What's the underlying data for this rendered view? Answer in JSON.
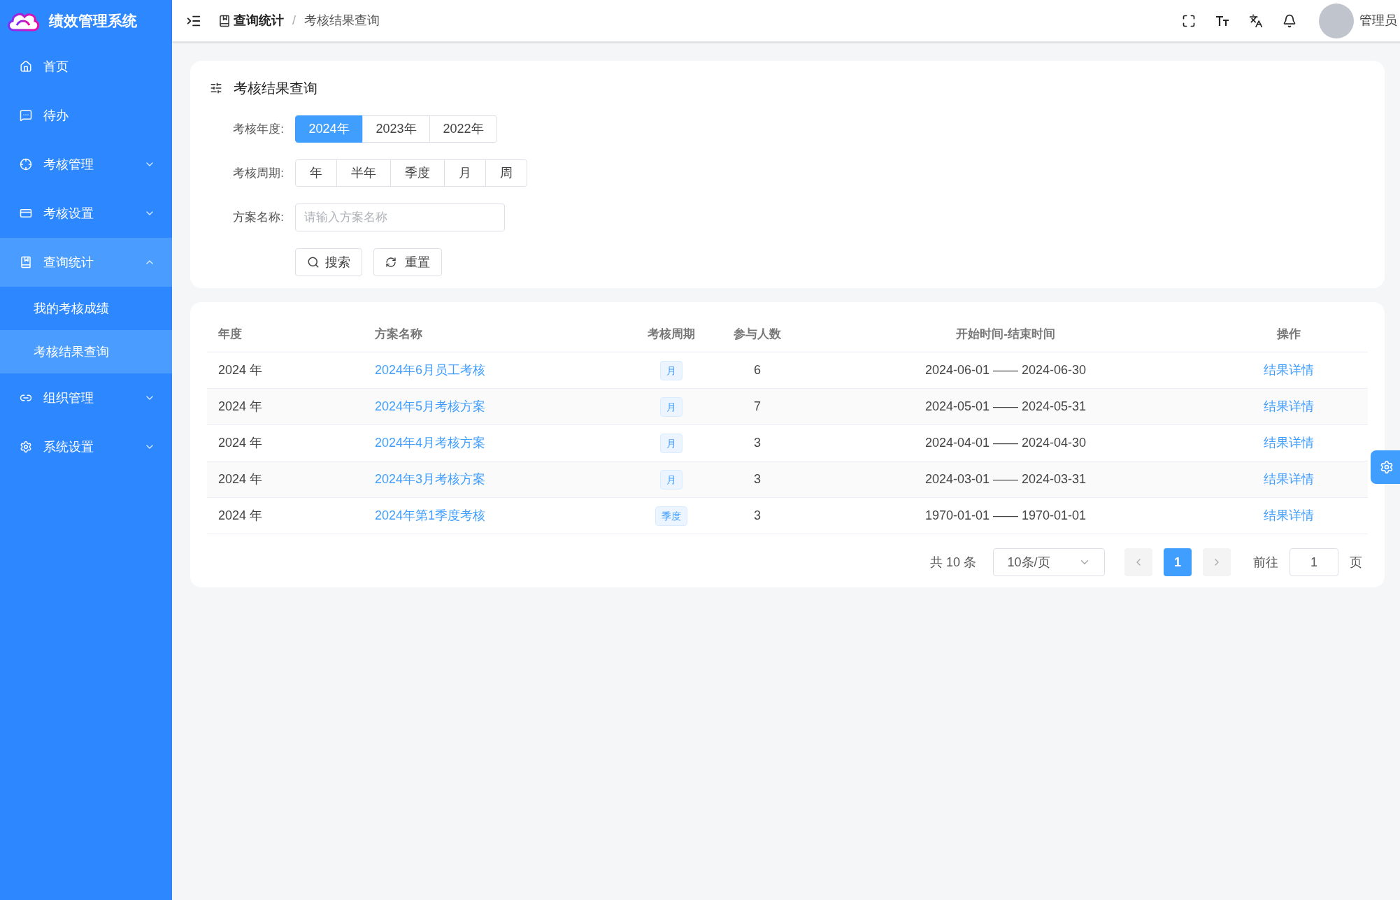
{
  "app": {
    "title": "绩效管理系统"
  },
  "sidebar": {
    "items": [
      {
        "label": "首页",
        "kind": "link",
        "selected": false
      },
      {
        "label": "待办",
        "kind": "link",
        "selected": false
      },
      {
        "label": "考核管理",
        "kind": "group",
        "expanded": false,
        "selected": false
      },
      {
        "label": "考核设置",
        "kind": "group",
        "expanded": false,
        "selected": false
      },
      {
        "label": "查询统计",
        "kind": "group",
        "expanded": true,
        "selected": true,
        "children": [
          {
            "label": "我的考核成绩",
            "selected": false
          },
          {
            "label": "考核结果查询",
            "selected": true
          }
        ]
      },
      {
        "label": "组织管理",
        "kind": "group",
        "expanded": false,
        "selected": false
      },
      {
        "label": "系统设置",
        "kind": "group",
        "expanded": false,
        "selected": false
      }
    ]
  },
  "header": {
    "breadcrumb": [
      "查询统计",
      "考核结果查询"
    ],
    "separator": "/",
    "user": "管理员"
  },
  "filter": {
    "title": "考核结果查询",
    "year_label": "考核年度:",
    "years": [
      {
        "label": "2024年",
        "selected": true
      },
      {
        "label": "2023年",
        "selected": false
      },
      {
        "label": "2022年",
        "selected": false
      }
    ],
    "period_label": "考核周期:",
    "periods": [
      {
        "label": "年",
        "selected": false
      },
      {
        "label": "半年",
        "selected": false
      },
      {
        "label": "季度",
        "selected": false
      },
      {
        "label": "月",
        "selected": false
      },
      {
        "label": "周",
        "selected": false
      }
    ],
    "name_label": "方案名称:",
    "name_placeholder": "请输入方案名称",
    "search_button": "搜索",
    "reset_button": "重置"
  },
  "table": {
    "columns": [
      "年度",
      "方案名称",
      "考核周期",
      "参与人数",
      "开始时间-结束时间",
      "操作"
    ],
    "rows": [
      {
        "year": "2024 年",
        "name": "2024年6月员工考核",
        "period": "月",
        "count": "6",
        "range": "2024-06-01 —— 2024-06-30",
        "action": "结果详情"
      },
      {
        "year": "2024 年",
        "name": "2024年5月考核方案",
        "period": "月",
        "count": "7",
        "range": "2024-05-01 —— 2024-05-31",
        "action": "结果详情"
      },
      {
        "year": "2024 年",
        "name": "2024年4月考核方案",
        "period": "月",
        "count": "3",
        "range": "2024-04-01 —— 2024-04-30",
        "action": "结果详情"
      },
      {
        "year": "2024 年",
        "name": "2024年3月考核方案",
        "period": "月",
        "count": "3",
        "range": "2024-03-01 —— 2024-03-31",
        "action": "结果详情"
      },
      {
        "year": "2024 年",
        "name": "2024年第1季度考核",
        "period": "季度",
        "count": "3",
        "range": "1970-01-01 —— 1970-01-01",
        "action": "结果详情"
      }
    ]
  },
  "pagination": {
    "total": "共 10 条",
    "page_size": "10条/页",
    "pages": [
      {
        "label": "1",
        "selected": true
      }
    ],
    "goto_label": "前往",
    "goto_value": "1",
    "page_suffix": "页"
  }
}
